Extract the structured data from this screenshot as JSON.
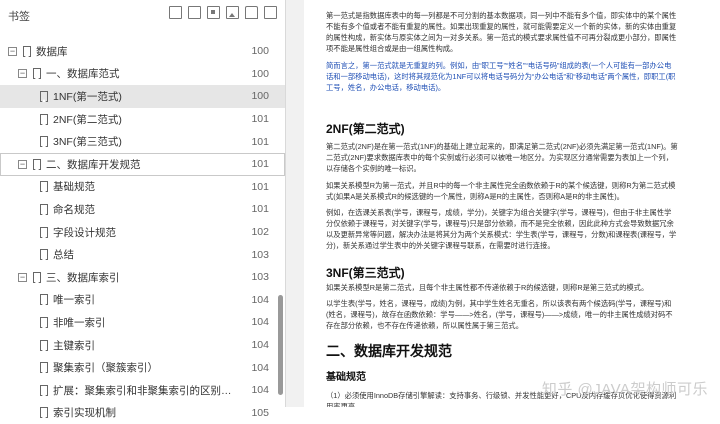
{
  "sidebar": {
    "title": "书签",
    "items": [
      {
        "level": 0,
        "toggle": "−",
        "label": "数据库",
        "page": "100"
      },
      {
        "level": 1,
        "toggle": "−",
        "label": "一、数据库范式",
        "page": "100"
      },
      {
        "level": 2,
        "toggle": "",
        "label": "1NF(第一范式)",
        "page": "100",
        "selected": true
      },
      {
        "level": 2,
        "toggle": "",
        "label": "2NF(第二范式)",
        "page": "101"
      },
      {
        "level": 2,
        "toggle": "",
        "label": "3NF(第三范式)",
        "page": "101"
      },
      {
        "level": 1,
        "toggle": "−",
        "label": "二、数据库开发规范",
        "page": "101",
        "focus": true
      },
      {
        "level": 2,
        "toggle": "",
        "label": "基础规范",
        "page": "101"
      },
      {
        "level": 2,
        "toggle": "",
        "label": "命名规范",
        "page": "101"
      },
      {
        "level": 2,
        "toggle": "",
        "label": "字段设计规范",
        "page": "102"
      },
      {
        "level": 2,
        "toggle": "",
        "label": "总结",
        "page": "103"
      },
      {
        "level": 1,
        "toggle": "−",
        "label": "三、数据库索引",
        "page": "103"
      },
      {
        "level": 2,
        "toggle": "",
        "label": "唯一索引",
        "page": "104"
      },
      {
        "level": 2,
        "toggle": "",
        "label": "非唯一索引",
        "page": "104"
      },
      {
        "level": 2,
        "toggle": "",
        "label": "主键索引",
        "page": "104"
      },
      {
        "level": 2,
        "toggle": "",
        "label": "聚集索引（聚簇索引）",
        "page": "104"
      },
      {
        "level": 2,
        "toggle": "",
        "label": "扩展：聚集索引和非聚集索引的区别？分别在...",
        "page": "104"
      },
      {
        "level": 2,
        "toggle": "",
        "label": "索引实现机制",
        "page": "105"
      }
    ]
  },
  "content": {
    "p1_a": "第一范式是指数据库表中的每一列都是不可分割的基本数据项，同一列中不能有多个值，即实体中的某个属性不能有多个值或者不能有重复的属性。如果出现重复的属性，就可能需要定义一个新的实体，新的实体由重复的属性构成，新实体与原实体之间为一对多关系。第一范式的模式要求属性值不可再分裂成更小部分，即属性项不能是属性组合或是由一组属性构成。",
    "p1_b": "简而言之，第一范式就是无重复的列。例如，由“职工号”“姓名”“电话号码”组成的表(一个人可能有一部办公电话和一部移动电话)，这时将其规范化为1NF可以将电话号码分为“办公电话”和“移动电话”两个属性，即职工(职工号，姓名，办公电话，移动电话)。",
    "h_2nf": "2NF(第二范式)",
    "p2_a": "第二范式(2NF)是在第一范式(1NF)的基础上建立起来的，即满足第二范式(2NF)必须先满足第一范式(1NF)。第二范式(2NF)要求数据库表中的每个实例或行必须可以被唯一地区分。为实现区分通常需要为表加上一个列，以存储各个实例的唯一标识。",
    "p2_b": "如果关系模型R为第一范式，并且R中的每一个非主属性完全函数依赖于R的某个候选键，则称R为第二范式模式(如果A是关系模式R的候选键的一个属性，则称A是R的主属性，否则称A是R的非主属性)。",
    "p2_c": "例如，在选课关系表(学号，课程号，成绩，学分)，关键字为组合关键字(学号，课程号)，但由于非主属性学分仅依赖于课程号，对关键字(学号，课程号)只是部分依赖，而不是完全依赖，因此此种方式会导致数据冗余以及更新异常等问题，解决办法是将其分为两个关系模式：学生表(学号，课程号，分数)和课程表(课程号，学分)，新关系通过学生表中的外关键字课程号联系，在需要时进行连接。",
    "h_3nf": "3NF(第三范式)",
    "p3_a": "如果关系模型R是第二范式，且每个非主属性都不传递依赖于R的候选键，则称R是第三范式的模式。",
    "p3_b": "以学生表(学号，姓名，课程号，成绩)为例，其中学生姓名无重名，所以该表有两个候选码(学号，课程号)和(姓名，课程号)，故存在函数依赖：学号——>姓名，(学号，课程号)——>成绩，唯一的非主属性成绩对码不存在部分依赖，也不存在传递依赖，所以属性属于第三范式。",
    "h_sec2": "二、数据库开发规范",
    "h_basic": "基础规范",
    "p4": "（1）必须使用InnoDB存储引擎解读：支持事务、行级锁、并发性能更好，CPU及内存缓存页优化使得资源利用率更高"
  },
  "watermark": "知乎 @JAVA架构师可乐"
}
